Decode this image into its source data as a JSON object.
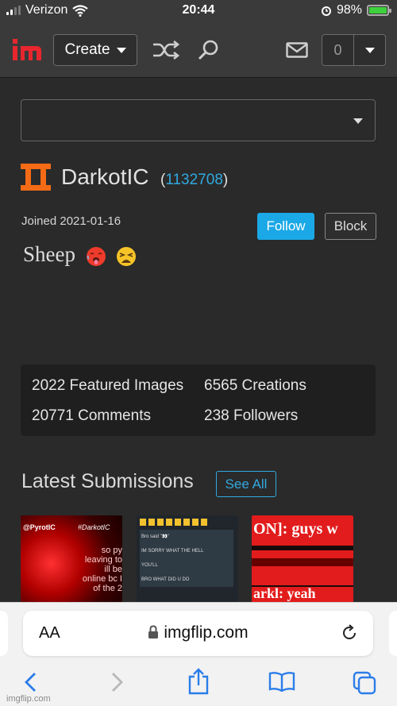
{
  "status": {
    "carrier": "Verizon",
    "time": "20:44",
    "battery": "98%"
  },
  "header": {
    "create_label": "Create",
    "notif_count": "0"
  },
  "profile": {
    "username": "DarkotIC",
    "user_id": "1132708",
    "joined": "Joined 2021-01-16",
    "follow_label": "Follow",
    "block_label": "Block",
    "bio": "Sheep"
  },
  "stats": {
    "featured": "2022 Featured Images",
    "creations": "6565 Creations",
    "comments": "20771 Comments",
    "followers": "238 Followers"
  },
  "latest": {
    "title": "Latest Submissions",
    "see_all_label": "See All",
    "thumb1": {
      "handle": "@PyrotIC",
      "tag": "#DarkotIC",
      "lines": [
        "so py",
        "leaving to",
        "ill be",
        "online bc I",
        "of the 2"
      ]
    },
    "thumb2": {
      "lines": [
        "Bro said \"👀\"",
        "IM SORRY WHAT THE HELL",
        "YOU'LL",
        "BRO WHAT DID U DO"
      ]
    },
    "thumb3": {
      "lines": [
        "ON]: guys w",
        "arkl: yeah"
      ]
    }
  },
  "safari": {
    "aa_label": "AA",
    "url": "imgflip.com"
  },
  "watermark": "imgflip.com",
  "colors": {
    "accent": "#1ba8e6",
    "link": "#31a9e0",
    "brand_orange": "#f46a15",
    "logo_red": "#e8262e"
  }
}
